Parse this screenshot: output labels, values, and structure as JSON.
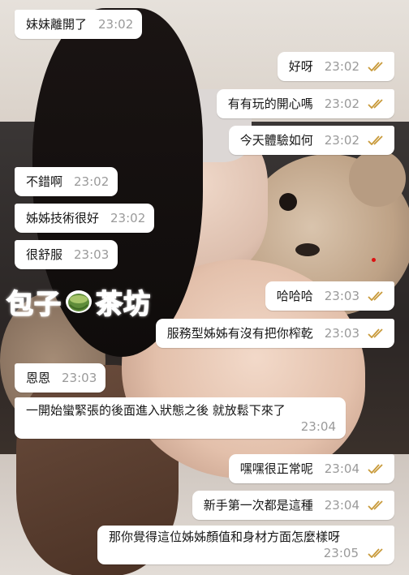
{
  "logo": {
    "text_left": "包子",
    "text_right": "茶坊"
  },
  "colors": {
    "bubble": "#ffffff",
    "time": "#9a9a9a",
    "tick": "#c89a3a",
    "logo": "#f07ab6"
  },
  "messages": [
    {
      "dir": "in",
      "text": "妹妹離開了",
      "time": "23:02"
    },
    {
      "dir": "out",
      "text": "好呀",
      "time": "23:02",
      "ticks": true
    },
    {
      "dir": "out",
      "text": "有有玩的開心嗎",
      "time": "23:02",
      "ticks": true
    },
    {
      "dir": "out",
      "text": "今天體驗如何",
      "time": "23:02",
      "ticks": true
    },
    {
      "dir": "in",
      "text": "不錯啊",
      "time": "23:02"
    },
    {
      "dir": "in",
      "text": "姊姊技術很好",
      "time": "23:02"
    },
    {
      "dir": "in",
      "text": "很舒服",
      "time": "23:03"
    },
    {
      "dir": "out",
      "text": "哈哈哈",
      "time": "23:03",
      "ticks": true
    },
    {
      "dir": "out",
      "text": "服務型姊姊有沒有把你榨乾",
      "time": "23:03",
      "ticks": true
    },
    {
      "dir": "in",
      "text": "恩恩",
      "time": "23:03"
    },
    {
      "dir": "in",
      "text": "一開始蠻緊張的後面進入狀態之後 就放鬆下來了",
      "time": "23:04"
    },
    {
      "dir": "out",
      "text": "嘿嘿很正常呢",
      "time": "23:04",
      "ticks": true
    },
    {
      "dir": "out",
      "text": "新手第一次都是這種",
      "time": "23:04",
      "ticks": true
    },
    {
      "dir": "out",
      "text": "那你覺得這位姊姊顏值和身材方面怎麼樣呀",
      "time": "23:05",
      "ticks": true
    }
  ]
}
